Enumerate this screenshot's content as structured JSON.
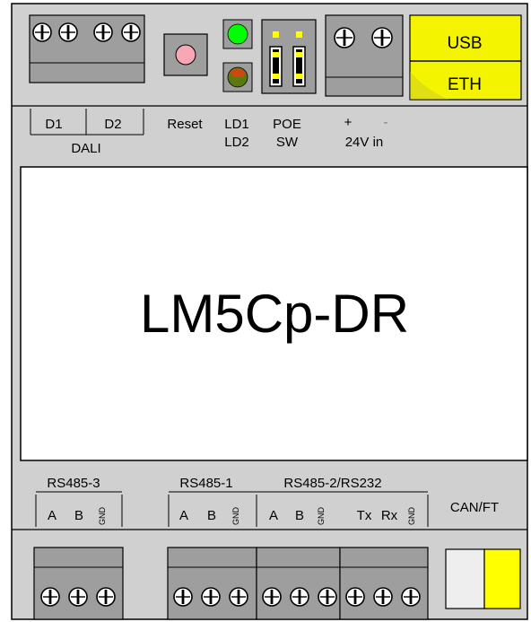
{
  "colors": {
    "housing": "#d0d0d0",
    "terminal": "#9e9e9e",
    "terminal_dark": "#888888",
    "usb_eth": "#f4f400",
    "led_green": "#00ff00",
    "reset_button": "#f6a8b4",
    "jumper_cap": "#ffff00",
    "can_ft_left": "#eeeeee",
    "can_ft_right": "#ffff00"
  },
  "icons": {
    "screw": "screw-terminal-icon",
    "led": "led-indicator-icon",
    "jumper": "jumper-icon"
  },
  "device": {
    "model": "LM5Cp-DR"
  },
  "top_ports": {
    "usb_label": "USB",
    "eth_label": "ETH"
  },
  "top_labels": {
    "d1": "D1",
    "d2": "D2",
    "dali": "DALI",
    "reset": "Reset",
    "ld1": "LD1",
    "ld2": "LD2",
    "poe": "POE",
    "sw": "SW",
    "plus": "+",
    "minus": "-",
    "power": "24V in"
  },
  "bottom_labels": {
    "rs485_3": "RS485-3",
    "rs485_1": "RS485-1",
    "rs485_2": "RS485-2/RS232",
    "a": "A",
    "b": "B",
    "gnd": "GND",
    "tx": "Tx",
    "rx": "Rx",
    "can_ft": "CAN/FT"
  }
}
